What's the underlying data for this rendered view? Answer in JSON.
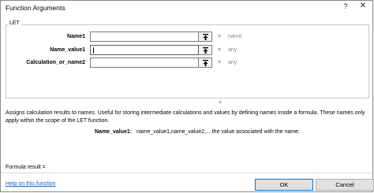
{
  "window": {
    "title": "Function Arguments",
    "help_glyph": "?",
    "close_glyph": "✕"
  },
  "group": {
    "label": "LET"
  },
  "args": [
    {
      "label": "Name1",
      "value": "",
      "eq": "=",
      "hint": "name"
    },
    {
      "label": "Name_value1",
      "value": "",
      "eq": "=",
      "hint": "any"
    },
    {
      "label": "Calculation_or_name2",
      "value": "",
      "eq": "=",
      "hint": "any"
    }
  ],
  "result_eq": "=",
  "description": "Assigns calculation results to names. Useful for storing intermediate calculations and values by defining names inside a formula. These names only apply within the scope of the LET function.",
  "arg_help": {
    "name": "Name_value1:",
    "text": "name_value1,name_value2,... the value associated with the name."
  },
  "footer": {
    "formula_result": "Formula result =",
    "help_link": "Help on this function",
    "ok": "OK",
    "cancel": "Cancel"
  }
}
